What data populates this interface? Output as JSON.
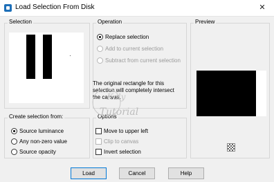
{
  "window": {
    "title": "Load Selection From Disk",
    "close_glyph": "✕",
    "icon": "app-icon"
  },
  "selection": {
    "label": "Selection"
  },
  "operation": {
    "label": "Operation",
    "options": [
      {
        "label": "Replace selection",
        "checked": true,
        "enabled": true
      },
      {
        "label": "Add to current selection",
        "checked": false,
        "enabled": false
      },
      {
        "label": "Subtract from current selection",
        "checked": false,
        "enabled": false
      }
    ],
    "info_line1": "The original rectangle for this",
    "info_line2": "selection will completely intersect",
    "info_line3": "the canvas."
  },
  "preview": {
    "label": "Preview",
    "navigator_icon": "navigator-icon"
  },
  "create_from": {
    "label": "Create selection from:",
    "options": [
      {
        "label": "Source luminance",
        "checked": true
      },
      {
        "label": "Any non-zero value",
        "checked": false
      },
      {
        "label": "Source opacity",
        "checked": false
      }
    ]
  },
  "options": {
    "label": "Options",
    "items": [
      {
        "label": "Move to upper left",
        "checked": false,
        "enabled": true
      },
      {
        "label": "Clip to canvas",
        "checked": false,
        "enabled": false
      },
      {
        "label": "Invert selection",
        "checked": false,
        "enabled": true
      }
    ]
  },
  "buttons": {
    "load": "Load",
    "cancel": "Cancel",
    "help": "Help"
  },
  "watermark_text": {
    "line1": "Kaly",
    "line2": "Tutorial"
  },
  "colors": {
    "dialog_bg": "#f0f0f0",
    "default_button_border": "#0078d7",
    "disabled_text": "#9a9a9a"
  }
}
